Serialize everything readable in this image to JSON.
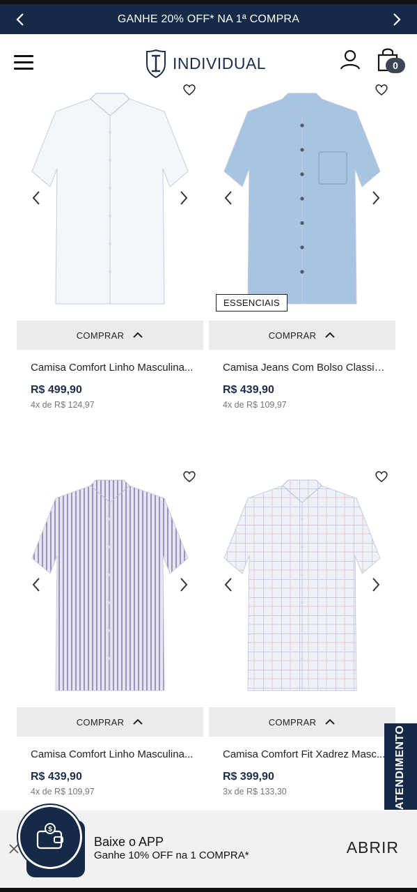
{
  "promo": {
    "text": "GANHE 20% OFF* NA 1ª COMPRA"
  },
  "header": {
    "logo_text": "INDIVIDUAL",
    "cart_count": "0"
  },
  "products": [
    {
      "name": "Camisa Comfort Linho Masculina...",
      "price": "R$ 499,90",
      "installments": "4x de R$ 124,97",
      "buy_label": "COMPRAR",
      "badge": "",
      "shirt_color": "#f3f6fa",
      "pattern": "plain"
    },
    {
      "name": "Camisa Jeans Com Bolso Classics...",
      "price": "R$ 439,90",
      "installments": "4x de R$ 109,97",
      "buy_label": "COMPRAR",
      "badge": "ESSENCIAIS",
      "shirt_color": "#a9c3e2",
      "pattern": "denim"
    },
    {
      "name": "Camisa Comfort Linho Masculina...",
      "price": "R$ 439,90",
      "installments": "4x de R$ 109,97",
      "buy_label": "COMPRAR",
      "badge": "",
      "shirt_color": "#e7e5f0",
      "pattern": "stripes"
    },
    {
      "name": "Camisa Comfort Fit Xadrez Masc...",
      "price": "R$ 399,90",
      "installments": "3x de R$ 133,30",
      "buy_label": "COMPRAR",
      "badge": "",
      "shirt_color": "#eef1f8",
      "pattern": "check"
    }
  ],
  "side_tab": {
    "label": "ATENDIMENTO"
  },
  "app_banner": {
    "title": "Baixe o APP",
    "subtitle": "Ganhe 10% OFF na 1 COMPRA*",
    "open_label": "ABRIR"
  },
  "colors": {
    "navy": "#152a47",
    "button_gray": "#ebebeb",
    "price_navy": "#1c2d4a"
  }
}
